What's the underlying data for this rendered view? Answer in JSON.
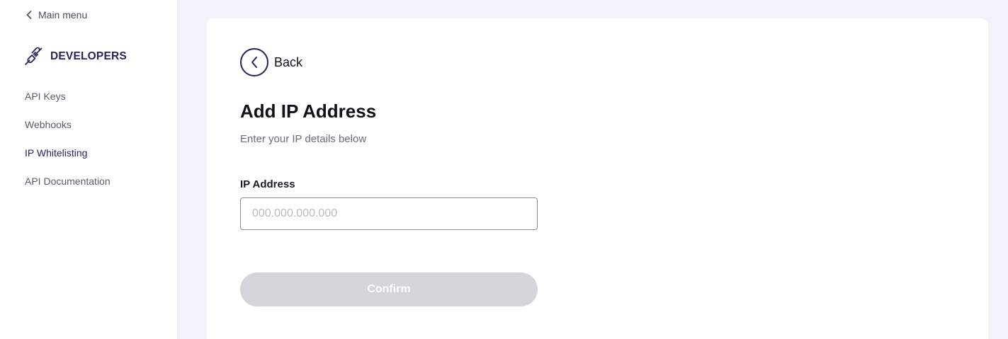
{
  "sidebar": {
    "main_menu_label": "Main menu",
    "back_icon": "chevron-left-icon",
    "section_icon": "plug-icon",
    "section_title": "DEVELOPERS",
    "items": [
      {
        "label": "API Keys",
        "active": false
      },
      {
        "label": "Webhooks",
        "active": false
      },
      {
        "label": "IP Whitelisting",
        "active": true
      },
      {
        "label": "API Documentation",
        "active": false
      }
    ]
  },
  "main": {
    "back_label": "Back",
    "title": "Add IP Address",
    "subtitle": "Enter your IP details below",
    "ip_field": {
      "label": "IP Address",
      "value": "",
      "placeholder": "000.000.000.000"
    },
    "confirm_label": "Confirm",
    "confirm_disabled": true
  },
  "colors": {
    "accent": "#2a1f5c",
    "page_background": "#f3f2fa",
    "card_background": "#ffffff",
    "button_disabled": "#d4d5da"
  }
}
